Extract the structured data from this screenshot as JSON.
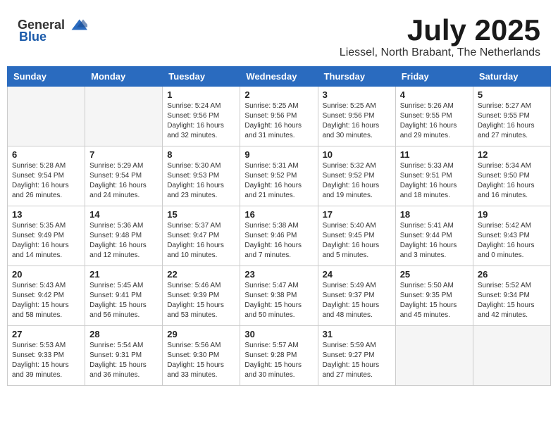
{
  "header": {
    "logo_general": "General",
    "logo_blue": "Blue",
    "month_title": "July 2025",
    "subtitle": "Liessel, North Brabant, The Netherlands"
  },
  "weekdays": [
    "Sunday",
    "Monday",
    "Tuesday",
    "Wednesday",
    "Thursday",
    "Friday",
    "Saturday"
  ],
  "weeks": [
    [
      {
        "day": "",
        "info": ""
      },
      {
        "day": "",
        "info": ""
      },
      {
        "day": "1",
        "info": "Sunrise: 5:24 AM\nSunset: 9:56 PM\nDaylight: 16 hours\nand 32 minutes."
      },
      {
        "day": "2",
        "info": "Sunrise: 5:25 AM\nSunset: 9:56 PM\nDaylight: 16 hours\nand 31 minutes."
      },
      {
        "day": "3",
        "info": "Sunrise: 5:25 AM\nSunset: 9:56 PM\nDaylight: 16 hours\nand 30 minutes."
      },
      {
        "day": "4",
        "info": "Sunrise: 5:26 AM\nSunset: 9:55 PM\nDaylight: 16 hours\nand 29 minutes."
      },
      {
        "day": "5",
        "info": "Sunrise: 5:27 AM\nSunset: 9:55 PM\nDaylight: 16 hours\nand 27 minutes."
      }
    ],
    [
      {
        "day": "6",
        "info": "Sunrise: 5:28 AM\nSunset: 9:54 PM\nDaylight: 16 hours\nand 26 minutes."
      },
      {
        "day": "7",
        "info": "Sunrise: 5:29 AM\nSunset: 9:54 PM\nDaylight: 16 hours\nand 24 minutes."
      },
      {
        "day": "8",
        "info": "Sunrise: 5:30 AM\nSunset: 9:53 PM\nDaylight: 16 hours\nand 23 minutes."
      },
      {
        "day": "9",
        "info": "Sunrise: 5:31 AM\nSunset: 9:52 PM\nDaylight: 16 hours\nand 21 minutes."
      },
      {
        "day": "10",
        "info": "Sunrise: 5:32 AM\nSunset: 9:52 PM\nDaylight: 16 hours\nand 19 minutes."
      },
      {
        "day": "11",
        "info": "Sunrise: 5:33 AM\nSunset: 9:51 PM\nDaylight: 16 hours\nand 18 minutes."
      },
      {
        "day": "12",
        "info": "Sunrise: 5:34 AM\nSunset: 9:50 PM\nDaylight: 16 hours\nand 16 minutes."
      }
    ],
    [
      {
        "day": "13",
        "info": "Sunrise: 5:35 AM\nSunset: 9:49 PM\nDaylight: 16 hours\nand 14 minutes."
      },
      {
        "day": "14",
        "info": "Sunrise: 5:36 AM\nSunset: 9:48 PM\nDaylight: 16 hours\nand 12 minutes."
      },
      {
        "day": "15",
        "info": "Sunrise: 5:37 AM\nSunset: 9:47 PM\nDaylight: 16 hours\nand 10 minutes."
      },
      {
        "day": "16",
        "info": "Sunrise: 5:38 AM\nSunset: 9:46 PM\nDaylight: 16 hours\nand 7 minutes."
      },
      {
        "day": "17",
        "info": "Sunrise: 5:40 AM\nSunset: 9:45 PM\nDaylight: 16 hours\nand 5 minutes."
      },
      {
        "day": "18",
        "info": "Sunrise: 5:41 AM\nSunset: 9:44 PM\nDaylight: 16 hours\nand 3 minutes."
      },
      {
        "day": "19",
        "info": "Sunrise: 5:42 AM\nSunset: 9:43 PM\nDaylight: 16 hours\nand 0 minutes."
      }
    ],
    [
      {
        "day": "20",
        "info": "Sunrise: 5:43 AM\nSunset: 9:42 PM\nDaylight: 15 hours\nand 58 minutes."
      },
      {
        "day": "21",
        "info": "Sunrise: 5:45 AM\nSunset: 9:41 PM\nDaylight: 15 hours\nand 56 minutes."
      },
      {
        "day": "22",
        "info": "Sunrise: 5:46 AM\nSunset: 9:39 PM\nDaylight: 15 hours\nand 53 minutes."
      },
      {
        "day": "23",
        "info": "Sunrise: 5:47 AM\nSunset: 9:38 PM\nDaylight: 15 hours\nand 50 minutes."
      },
      {
        "day": "24",
        "info": "Sunrise: 5:49 AM\nSunset: 9:37 PM\nDaylight: 15 hours\nand 48 minutes."
      },
      {
        "day": "25",
        "info": "Sunrise: 5:50 AM\nSunset: 9:35 PM\nDaylight: 15 hours\nand 45 minutes."
      },
      {
        "day": "26",
        "info": "Sunrise: 5:52 AM\nSunset: 9:34 PM\nDaylight: 15 hours\nand 42 minutes."
      }
    ],
    [
      {
        "day": "27",
        "info": "Sunrise: 5:53 AM\nSunset: 9:33 PM\nDaylight: 15 hours\nand 39 minutes."
      },
      {
        "day": "28",
        "info": "Sunrise: 5:54 AM\nSunset: 9:31 PM\nDaylight: 15 hours\nand 36 minutes."
      },
      {
        "day": "29",
        "info": "Sunrise: 5:56 AM\nSunset: 9:30 PM\nDaylight: 15 hours\nand 33 minutes."
      },
      {
        "day": "30",
        "info": "Sunrise: 5:57 AM\nSunset: 9:28 PM\nDaylight: 15 hours\nand 30 minutes."
      },
      {
        "day": "31",
        "info": "Sunrise: 5:59 AM\nSunset: 9:27 PM\nDaylight: 15 hours\nand 27 minutes."
      },
      {
        "day": "",
        "info": ""
      },
      {
        "day": "",
        "info": ""
      }
    ]
  ]
}
